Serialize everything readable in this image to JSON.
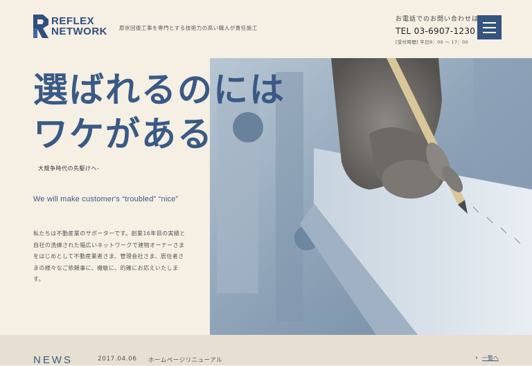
{
  "header": {
    "logo_line1": "REFLEX",
    "logo_line2": "NETWORK",
    "tagline": "原状回復工事を専門とする技術力の高い職人が責任施工",
    "contact_label": "お電話でのお問い合わせは",
    "tel": "TEL 03-6907-1230",
    "hours": "[受付時間] 平日9：00 〜 17：00",
    "menu_icon": "hamburger-icon"
  },
  "hero": {
    "headline_line1": "選ばれるのには",
    "headline_line2": "ワケがある",
    "subhead": "大競争時代の先駆けへ-",
    "slogan": "We will make customer's “troubled” “nice”",
    "intro": "私たちは不動産業のサポーターです。創業16年目の実績と自社の洗練された幅広いネットワークで建物オーナーさまをはじめとして不動産業者さま、管理会社さま、居住者さまの様々なご依頼事に、機敏に、的確にお応えいたします。"
  },
  "news": {
    "title": "NEWS",
    "date": "2017.04.06",
    "headline": "ホームページリニューアル",
    "more_label": "一覧へ",
    "more_icon": "chevron-right-icon"
  },
  "colors": {
    "background": "#f5efe4",
    "accent": "#34537e",
    "news_bar": "#e7dfd1"
  }
}
